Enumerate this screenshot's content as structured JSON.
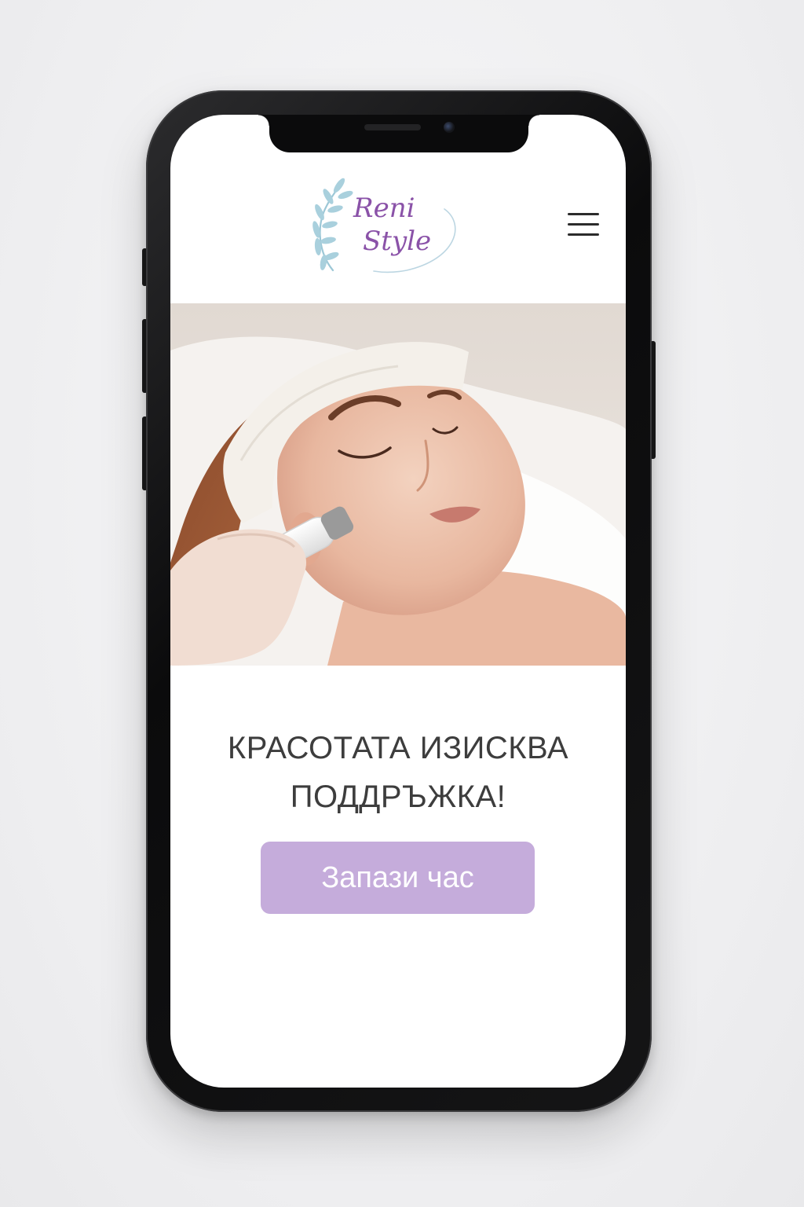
{
  "brand": {
    "logo_line1": "Reni",
    "logo_line2": "Style"
  },
  "hero": {
    "headline_line1": "КРАСОТАТА ИЗИСКВА",
    "headline_line2": "ПОДДРЪЖКА!"
  },
  "cta": {
    "label": "Запази час"
  },
  "icons": {
    "menu": "hamburger-menu-icon",
    "logo_decoration": "leaf-branch-icon"
  },
  "colors": {
    "accent": "#c5acdb",
    "logo_text": "#8a52a8",
    "logo_leaf": "#9cc7d6",
    "headline": "#3d3d3d",
    "phone_frame": "#0b0b0c"
  }
}
